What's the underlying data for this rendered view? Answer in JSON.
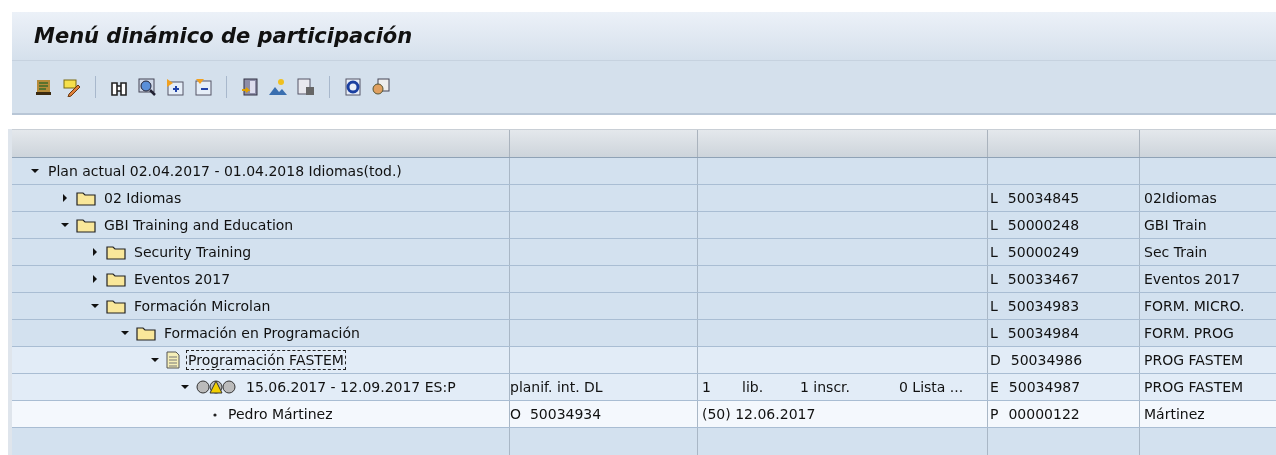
{
  "window": {
    "title": "Menú dinámico de participación"
  },
  "table": {
    "tree": [
      {
        "label": "Plan actual 02.04.2017 - 01.04.2018 Idiomas(tod.)",
        "kind": "plan",
        "expanded": true,
        "selected": false,
        "children": [
          {
            "label": "02 Idiomas",
            "kind": "folder",
            "expanded": false,
            "selected": false,
            "type": "L",
            "id": "50034845",
            "short": "02Idiomas"
          },
          {
            "label": "GBI Training and Education",
            "kind": "folder",
            "expanded": true,
            "selected": false,
            "type": "L",
            "id": "50000248",
            "short": "GBI Train",
            "children": [
              {
                "label": "Security Training",
                "kind": "folder",
                "expanded": false,
                "selected": false,
                "type": "L",
                "id": "50000249",
                "short": "Sec Train"
              },
              {
                "label": "Eventos 2017",
                "kind": "folder",
                "expanded": false,
                "selected": false,
                "type": "L",
                "id": "50033467",
                "short": "Eventos 2017"
              },
              {
                "label": "Formación Microlan",
                "kind": "folder",
                "expanded": true,
                "selected": false,
                "type": "L",
                "id": "50034983",
                "short": "FORM. MICRO.",
                "children": [
                  {
                    "label": "Formación en Programación",
                    "kind": "folder",
                    "expanded": true,
                    "selected": false,
                    "type": "L",
                    "id": "50034984",
                    "short": "FORM. PROG",
                    "children": [
                      {
                        "label": "Programación FASTEM",
                        "kind": "course",
                        "expanded": true,
                        "selected": true,
                        "type": "D",
                        "id": "50034986",
                        "short": "PROG FASTEM",
                        "children": [
                          {
                            "label": "15.06.2017 - 12.09.2017 ES:P",
                            "kind": "event",
                            "expanded": true,
                            "selected": false,
                            "col2": "planif. int. DL",
                            "col3": [
                              "1",
                              "lib.",
                              "1 inscr.",
                              "0 Lista ..."
                            ],
                            "type": "E",
                            "id": "50034987",
                            "short": "PROG FASTEM",
                            "children": [
                              {
                                "label": "Pedro Mártinez",
                                "kind": "participant",
                                "selected": false,
                                "col2": "O  50034934",
                                "col3": [
                                  "(50) 12.06.2017"
                                ],
                                "type": "P",
                                "id": "00000122",
                                "short": "Mártinez"
                              }
                            ]
                          }
                        ]
                      }
                    ]
                  }
                ]
              }
            ]
          }
        ]
      }
    ]
  }
}
